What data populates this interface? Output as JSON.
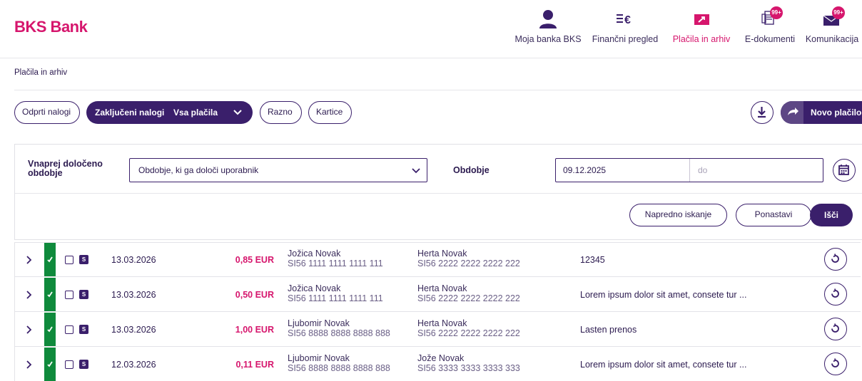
{
  "brand": {
    "name": "BKS Bank",
    "color": "#d6166d"
  },
  "nav": [
    {
      "label": "Moja banka BKS",
      "icon": "user-icon",
      "badge": ""
    },
    {
      "label": "Finančni pregled",
      "icon": "euro-list-icon",
      "badge": ""
    },
    {
      "label": "Plačila in arhiv",
      "icon": "payment-card-icon",
      "badge": ""
    },
    {
      "label": "E-dokumenti",
      "icon": "documents-icon",
      "badge": "99+"
    },
    {
      "label": "Komunikacija",
      "icon": "envelope-icon",
      "badge": "99+"
    }
  ],
  "breadcrumb": "Plačila in arhiv",
  "tabs": {
    "open": "Odprti nalogi",
    "closed": "Zaključeni nalogi",
    "all": "Vsa plačila",
    "misc": "Razno",
    "cards": "Kartice"
  },
  "actions": {
    "new_payment": "Novo plačilo",
    "download": "download-icon"
  },
  "filter": {
    "period_label": "Vnaprej določeno obdobje",
    "period_value": "Obdobje, ki ga določi uporabnik",
    "range_label": "Obdobje",
    "date_from": "09.12.2025",
    "date_to_placeholder": "do",
    "advanced": "Napredno iskanje",
    "reset": "Ponastavi",
    "search": "Išči"
  },
  "colors": {
    "primary": "#3a1f6b",
    "accent": "#d6166d",
    "status_ok": "#0f8a3c"
  },
  "rows": [
    {
      "date": "13.03.2026",
      "amount": "0,85 EUR",
      "amount_color": "#d6166d",
      "payer_name": "Jožica Novak",
      "payer_iban": "SI56 1111 1111 1111 111",
      "payee_name": "Herta Novak",
      "payee_iban": "SI56 2222 2222 2222 222",
      "purpose": "12345",
      "type_badge": "S"
    },
    {
      "date": "13.03.2026",
      "amount": "0,50 EUR",
      "amount_color": "#d6166d",
      "payer_name": "Jožica Novak",
      "payer_iban": "SI56 1111 1111 1111 111",
      "payee_name": "Herta Novak",
      "payee_iban": "SI56 2222 2222 2222 222",
      "purpose": "Lorem ipsum dolor sit amet, consete tur ...",
      "type_badge": "S"
    },
    {
      "date": "13.03.2026",
      "amount": "1,00 EUR",
      "amount_color": "#d6166d",
      "payer_name": "Ljubomir Novak",
      "payer_iban": "SI56 8888 8888 8888 888",
      "payee_name": "Herta Novak",
      "payee_iban": "SI56 2222 2222 2222 222",
      "purpose": "Lasten prenos",
      "type_badge": "S"
    },
    {
      "date": "12.03.2026",
      "amount": "0,11 EUR",
      "amount_color": "#d6166d",
      "payer_name": "Ljubomir Novak",
      "payer_iban": "SI56 8888 8888 8888 888",
      "payee_name": "Jože Novak",
      "payee_iban": "SI56 3333 3333 3333 333",
      "purpose": "Lorem ipsum dolor sit amet, consete tur ...",
      "type_badge": "S"
    }
  ]
}
